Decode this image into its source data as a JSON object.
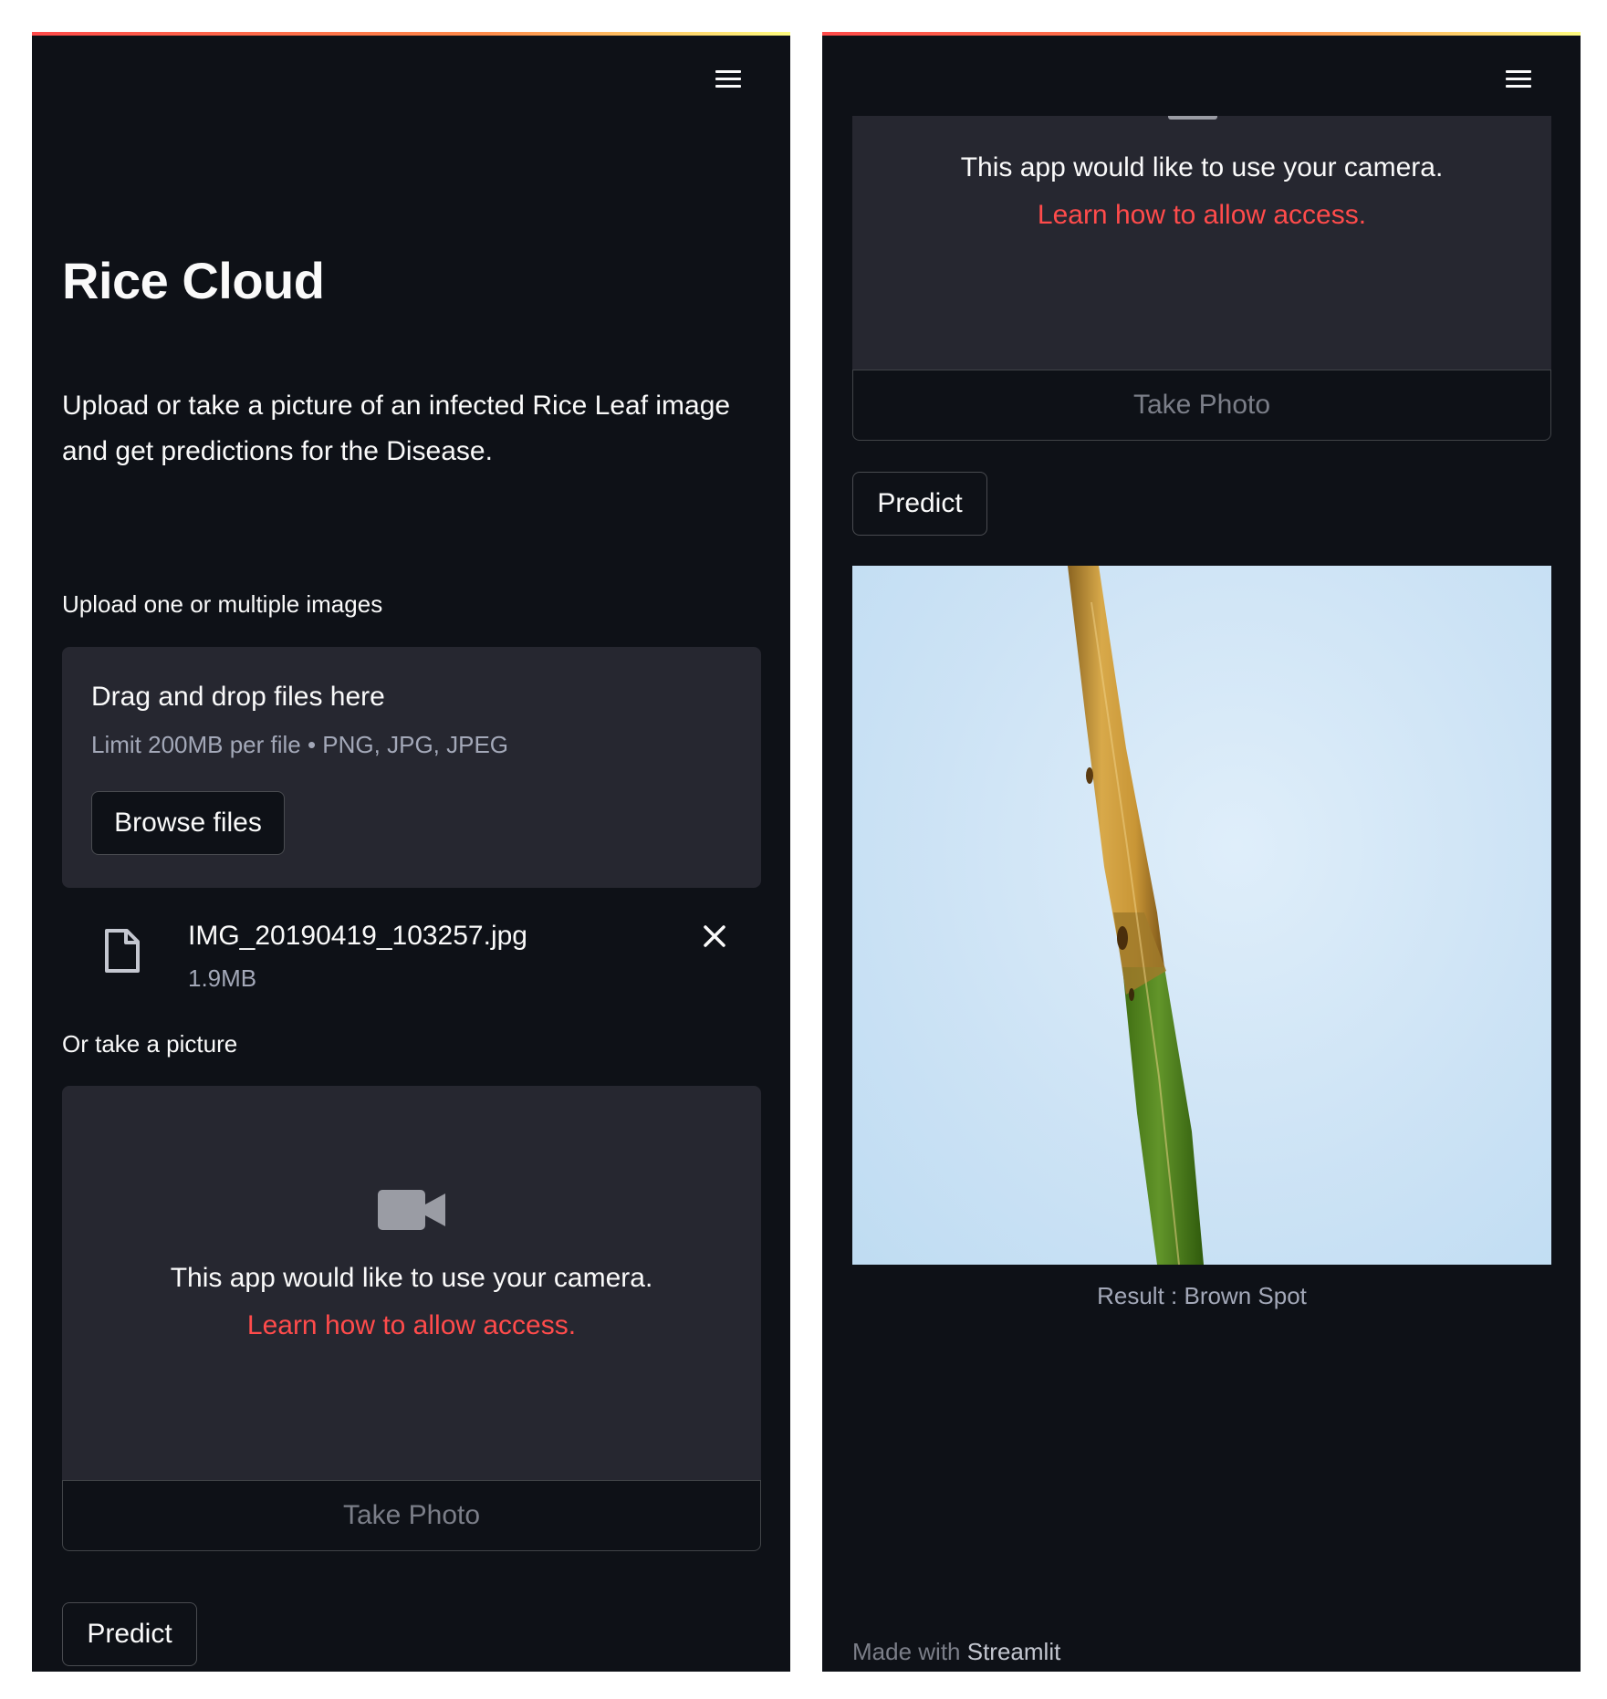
{
  "app": {
    "title": "Rice Cloud",
    "description": "Upload or take a picture of an infected Rice Leaf image and get predictions for the Disease."
  },
  "uploader": {
    "label": "Upload one or multiple images",
    "drop_title": "Drag and drop files here",
    "limit_text": "Limit 200MB per file • PNG, JPG, JPEG",
    "browse_label": "Browse files",
    "file": {
      "name": "IMG_20190419_103257.jpg",
      "size": "1.9MB"
    }
  },
  "camera": {
    "label": "Or take a picture",
    "message": "This app would like to use your camera.",
    "link": "Learn how to allow access.",
    "take_photo_label": "Take Photo"
  },
  "predict": {
    "label": "Predict"
  },
  "result": {
    "caption": "Result : Brown Spot"
  },
  "footer": {
    "prefix": "Made with",
    "brand": "Streamlit"
  },
  "icons": {
    "menu": "hamburger-menu-icon",
    "file": "file-icon",
    "remove": "close-icon",
    "camera": "video-camera-icon"
  },
  "colors": {
    "background": "#0e1117",
    "secondary_background": "#262730",
    "text": "#fafafa",
    "muted_text": "#a3a8b8",
    "accent": "#ff4b4b"
  }
}
